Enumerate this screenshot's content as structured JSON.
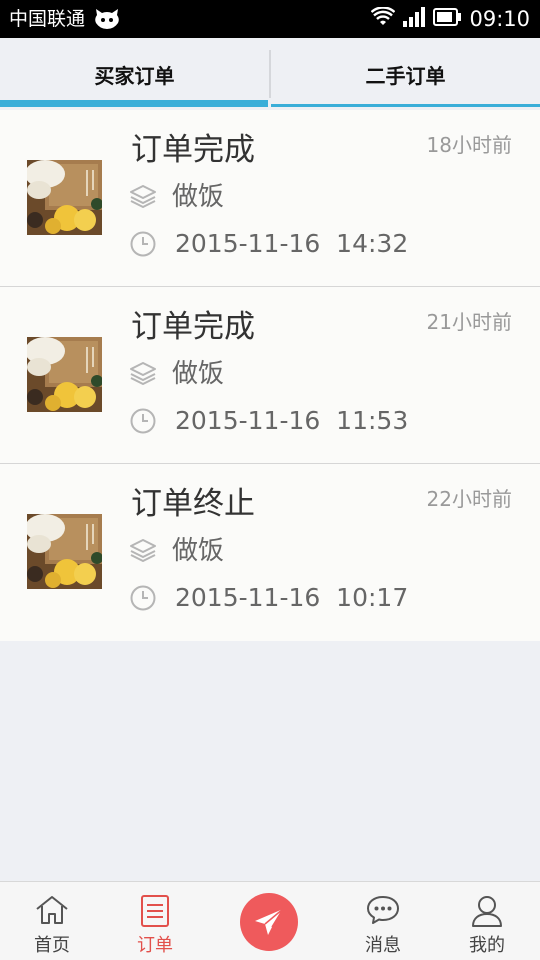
{
  "status_bar": {
    "carrier": "中国联通",
    "time": "09:10"
  },
  "tabs": [
    {
      "label": "买家订单",
      "active": true
    },
    {
      "label": "二手订单",
      "active": false
    }
  ],
  "orders": [
    {
      "status": "订单完成",
      "ago": "18小时前",
      "category": "做饭",
      "datetime": "2015-11-16  14:32"
    },
    {
      "status": "订单完成",
      "ago": "21小时前",
      "category": "做饭",
      "datetime": "2015-11-16  11:53"
    },
    {
      "status": "订单终止",
      "ago": "22小时前",
      "category": "做饭",
      "datetime": "2015-11-16  10:17"
    }
  ],
  "bottom_nav": {
    "home": "首页",
    "orders": "订单",
    "messages": "消息",
    "me": "我的"
  },
  "colors": {
    "accent_blue": "#3aaed8",
    "accent_red": "#ef5a5c",
    "active_nav": "#e2504b"
  },
  "icons": {
    "send": "paper-plane-icon",
    "home": "house-icon",
    "orders": "document-list-icon",
    "messages": "chat-bubble-icon",
    "me": "person-icon"
  }
}
